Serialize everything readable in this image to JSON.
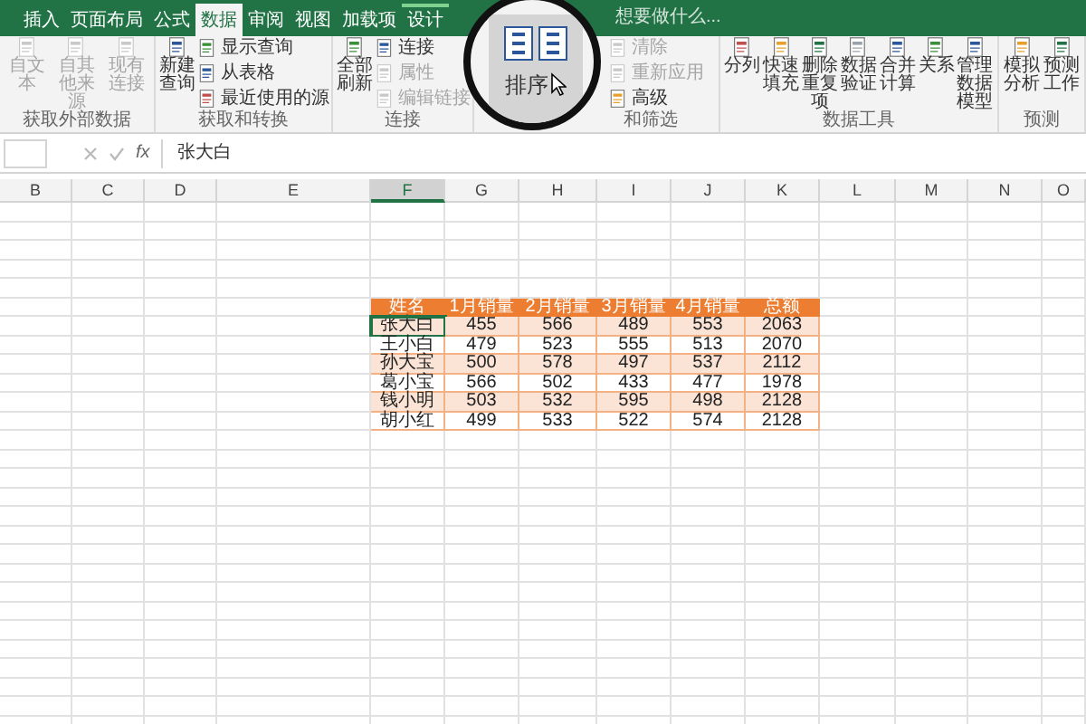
{
  "ribbon_tabs": [
    {
      "label": "插入",
      "selected": false,
      "contextual": false
    },
    {
      "label": "页面布局",
      "selected": false,
      "contextual": false
    },
    {
      "label": "公式",
      "selected": false,
      "contextual": false
    },
    {
      "label": "数据",
      "selected": true,
      "contextual": false
    },
    {
      "label": "审阅",
      "selected": false,
      "contextual": false
    },
    {
      "label": "视图",
      "selected": false,
      "contextual": false
    },
    {
      "label": "加载项",
      "selected": false,
      "contextual": false
    },
    {
      "label": "设计",
      "selected": false,
      "contextual": true
    }
  ],
  "tell_me": "想要做什么...",
  "ribbon_groups": [
    {
      "label": "获取外部数据",
      "items": [
        {
          "label": "自文本",
          "kind": "large",
          "disabled": true
        },
        {
          "label": "自其他来源",
          "kind": "large",
          "disabled": true
        },
        {
          "label": "现有连接",
          "kind": "large",
          "disabled": true
        }
      ]
    },
    {
      "label": "获取和转换",
      "items": [
        {
          "label": "新建查询",
          "kind": "large",
          "disabled": false
        },
        {
          "label": "显示查询",
          "kind": "small",
          "disabled": false
        },
        {
          "label": "从表格",
          "kind": "small",
          "disabled": false
        },
        {
          "label": "最近使用的源",
          "kind": "small",
          "disabled": false
        }
      ]
    },
    {
      "label": "连接",
      "items": [
        {
          "label": "全部刷新",
          "kind": "large",
          "disabled": false
        },
        {
          "label": "连接",
          "kind": "small",
          "disabled": false
        },
        {
          "label": "属性",
          "kind": "small",
          "disabled": true
        },
        {
          "label": "编辑链接",
          "kind": "small",
          "disabled": true
        }
      ]
    },
    {
      "label": "和筛选",
      "items": [
        {
          "label": "清除",
          "kind": "small",
          "disabled": true
        },
        {
          "label": "重新应用",
          "kind": "small",
          "disabled": true
        },
        {
          "label": "高级",
          "kind": "small",
          "disabled": false
        }
      ]
    },
    {
      "label": "数据工具",
      "items": [
        {
          "label": "分列",
          "kind": "large",
          "disabled": false
        },
        {
          "label": "快速填充",
          "kind": "large",
          "disabled": false
        },
        {
          "label": "删除重复项",
          "kind": "large",
          "disabled": false
        },
        {
          "label": "数据验证",
          "kind": "large",
          "disabled": false
        },
        {
          "label": "合并计算",
          "kind": "large",
          "disabled": false
        },
        {
          "label": "关系",
          "kind": "large",
          "disabled": false
        },
        {
          "label": "管理数据模型",
          "kind": "large",
          "disabled": false
        }
      ]
    },
    {
      "label": "预测",
      "items": [
        {
          "label": "模拟分析",
          "kind": "large",
          "disabled": false
        },
        {
          "label": "预测工作",
          "kind": "large",
          "disabled": false
        }
      ]
    }
  ],
  "magnifier": {
    "label": "排序"
  },
  "formula_bar": {
    "function_label": "fx",
    "value": "张大白"
  },
  "columns": [
    {
      "label": "B",
      "selected": false
    },
    {
      "label": "C",
      "selected": false
    },
    {
      "label": "D",
      "selected": false
    },
    {
      "label": "E",
      "selected": false
    },
    {
      "label": "F",
      "selected": true
    },
    {
      "label": "G",
      "selected": false
    },
    {
      "label": "H",
      "selected": false
    },
    {
      "label": "I",
      "selected": false
    },
    {
      "label": "J",
      "selected": false
    },
    {
      "label": "K",
      "selected": false
    },
    {
      "label": "L",
      "selected": false
    },
    {
      "label": "M",
      "selected": false
    },
    {
      "label": "N",
      "selected": false
    },
    {
      "label": "O",
      "selected": false
    }
  ],
  "table": {
    "columns": [
      "姓名",
      "1月销量",
      "2月销量",
      "3月销量",
      "4月销量",
      "总额"
    ],
    "rows": [
      {
        "cells": [
          "张大白",
          "455",
          "566",
          "489",
          "553",
          "2063"
        ],
        "selected": true
      },
      {
        "cells": [
          "王小白",
          "479",
          "523",
          "555",
          "513",
          "2070"
        ],
        "selected": false
      },
      {
        "cells": [
          "孙大宝",
          "500",
          "578",
          "497",
          "537",
          "2112"
        ],
        "selected": false
      },
      {
        "cells": [
          "葛小宝",
          "566",
          "502",
          "433",
          "477",
          "1978"
        ],
        "selected": false
      },
      {
        "cells": [
          "钱小明",
          "503",
          "532",
          "595",
          "498",
          "2128"
        ],
        "selected": false
      },
      {
        "cells": [
          "胡小红",
          "499",
          "533",
          "522",
          "574",
          "2128"
        ],
        "selected": false
      }
    ]
  }
}
